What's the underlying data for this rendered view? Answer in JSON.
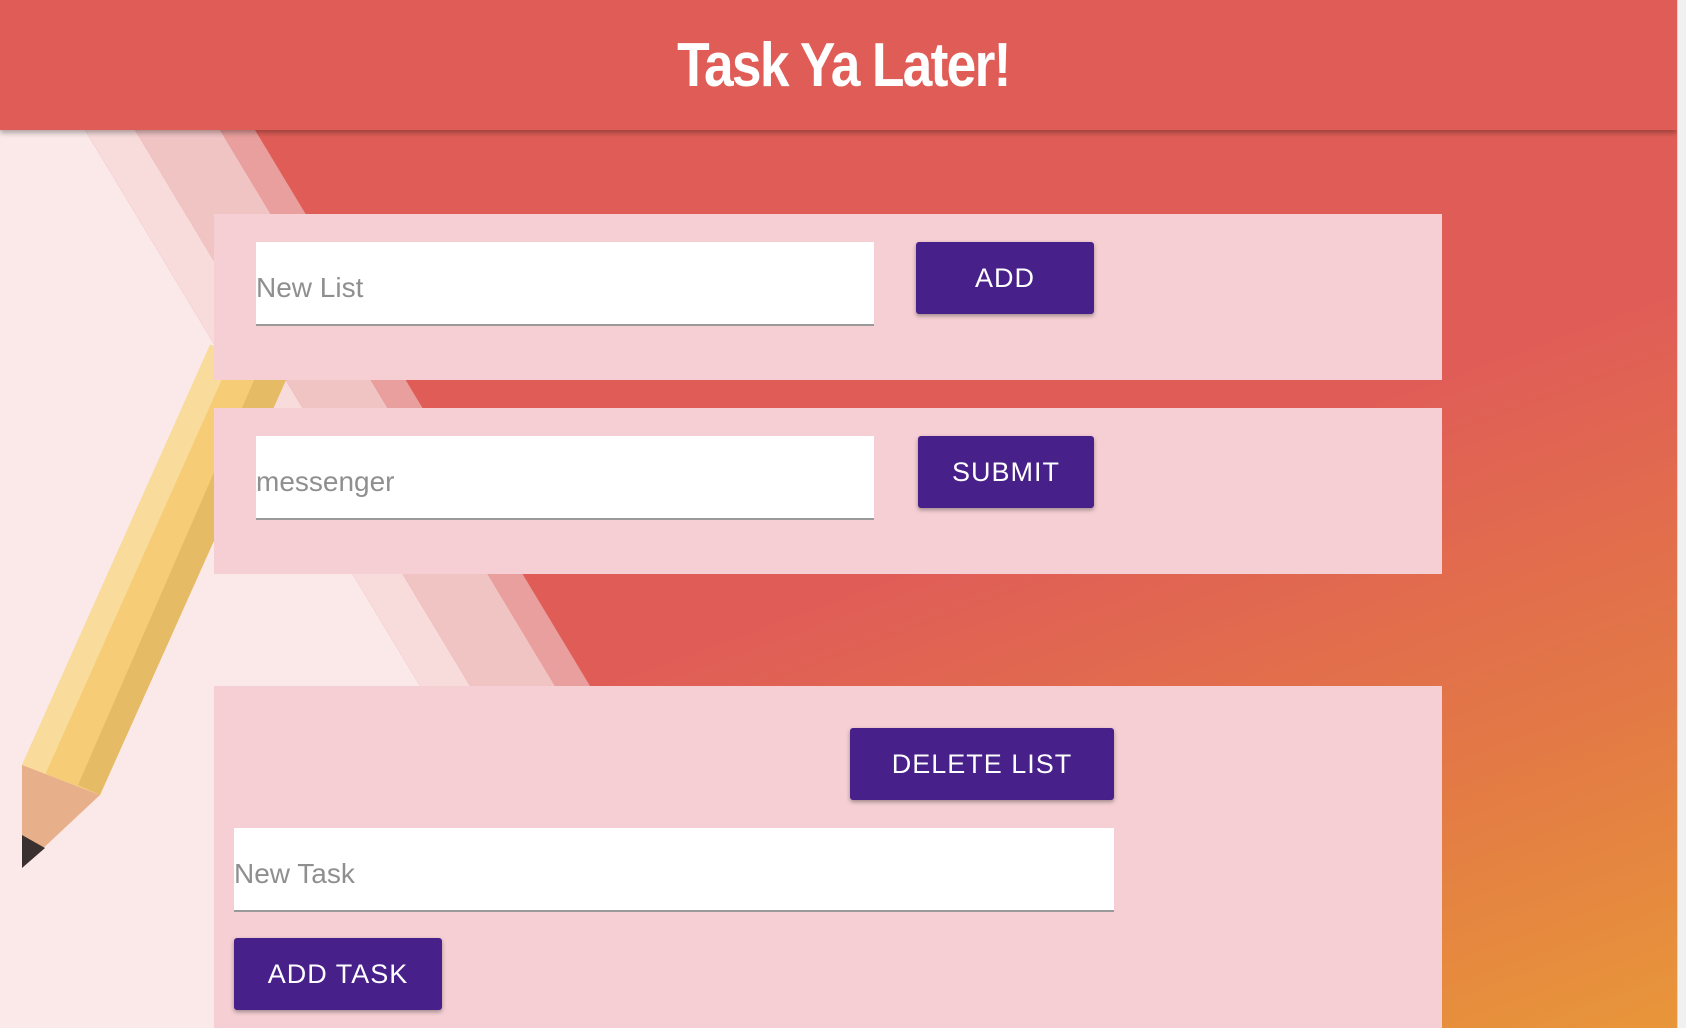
{
  "header": {
    "title": "Task Ya Later!"
  },
  "new_list": {
    "placeholder": "New List",
    "button_label": "ADD"
  },
  "list_name": {
    "value": "messenger",
    "button_label": "SUBMIT"
  },
  "list_card": {
    "delete_label": "DELETE LIST",
    "task_placeholder": "New Task",
    "add_task_label": "ADD TASK"
  },
  "colors": {
    "header_bg": "#e05d57",
    "card_bg": "#f5cfd3",
    "button_bg": "#48208a",
    "pencil": "#f6cd76"
  }
}
